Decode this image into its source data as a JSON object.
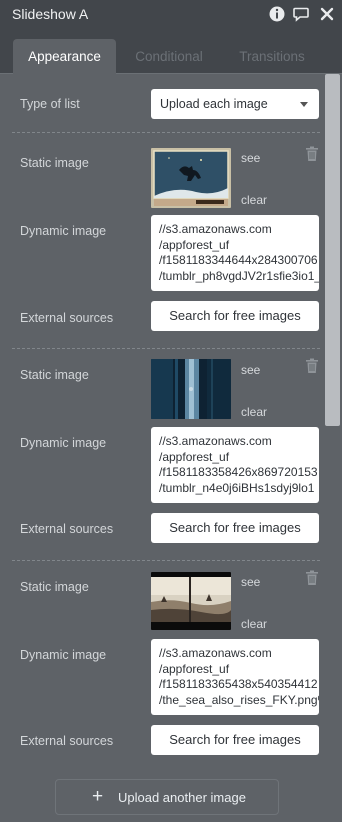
{
  "header": {
    "title": "Slideshow A",
    "icons": [
      "info-icon",
      "comment-icon",
      "close-icon"
    ]
  },
  "tabs": [
    {
      "label": "Appearance",
      "active": true
    },
    {
      "label": "Conditional",
      "active": false
    },
    {
      "label": "Transitions",
      "active": false
    }
  ],
  "type_of_list": {
    "label": "Type of list",
    "value": "Upload each image"
  },
  "images": [
    {
      "static_label": "Static image",
      "see": "see",
      "clear": "clear",
      "dynamic_label": "Dynamic image",
      "dynamic_lines": [
        "//s3.amazonaws.com",
        "/appforest_uf",
        "/f1581183344644x284300706",
        "/tumblr_ph8vgdJV2r1sfie3io1_"
      ],
      "external_label": "External sources",
      "search_button": "Search for free images"
    },
    {
      "static_label": "Static image",
      "see": "see",
      "clear": "clear",
      "dynamic_label": "Dynamic image",
      "dynamic_lines": [
        "//s3.amazonaws.com",
        "/appforest_uf",
        "/f1581183358426x869720153",
        "/tumblr_n4e0j6iBHs1sdyj9lo1"
      ],
      "external_label": "External sources",
      "search_button": "Search for free images"
    },
    {
      "static_label": "Static image",
      "see": "see",
      "clear": "clear",
      "dynamic_label": "Dynamic image",
      "dynamic_lines": [
        "//s3.amazonaws.com",
        "/appforest_uf",
        "/f1581183365438x540354412",
        "/the_sea_also_rises_FKY.png%"
      ],
      "external_label": "External sources",
      "search_button": "Search for free images"
    }
  ],
  "upload_button": "Upload another image",
  "colors": {
    "panel_bg": "#5e6267",
    "header_bg": "#42464b",
    "input_bg": "#ffffff",
    "scroll_thumb": "#b9bcc0"
  }
}
